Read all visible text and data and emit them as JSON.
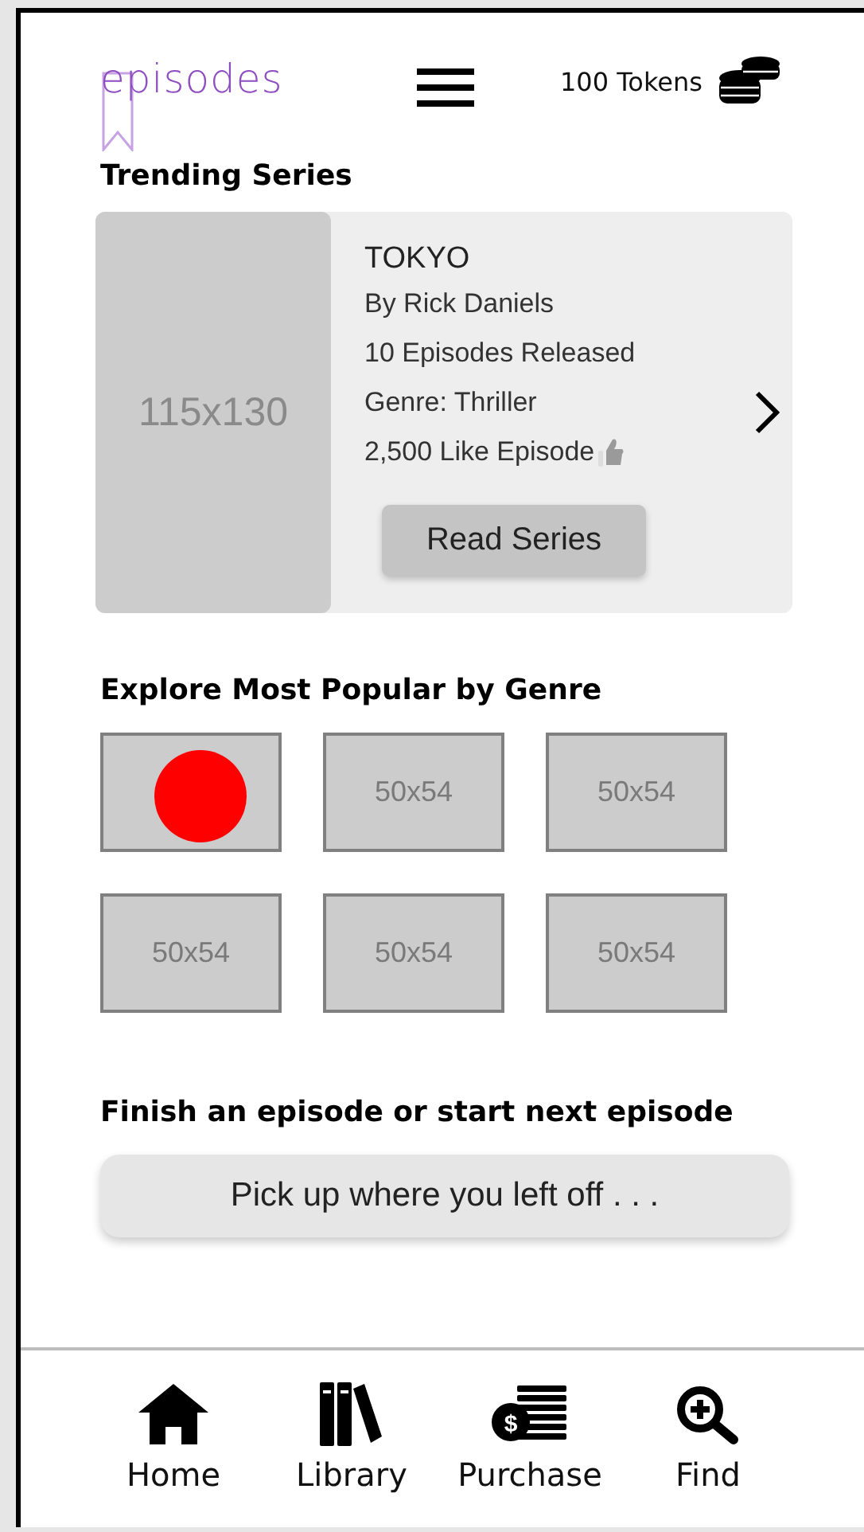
{
  "header": {
    "logo": "episodes",
    "tokens": "100 Tokens"
  },
  "trending": {
    "title": "Trending Series",
    "card": {
      "image_label": "115x130",
      "title": "TOKYO",
      "lines": [
        "By Rick Daniels",
        "10 Episodes Released",
        "Genre: Thriller",
        "2,500 Like Episode"
      ],
      "button": "Read Series"
    }
  },
  "genres": {
    "title": "Explore Most Popular by Genre",
    "tiles": [
      {
        "kind": "dot",
        "color": "#ff0000"
      },
      {
        "kind": "label",
        "label": "50x54"
      },
      {
        "kind": "label",
        "label": "50x54"
      },
      {
        "kind": "label",
        "label": "50x54"
      },
      {
        "kind": "label",
        "label": "50x54"
      },
      {
        "kind": "label",
        "label": "50x54"
      }
    ]
  },
  "continue": {
    "title": "Finish an episode or start next episode",
    "button": "Pick up where you left off . . ."
  },
  "nav": [
    {
      "kind": "home",
      "label": "Home"
    },
    {
      "kind": "library",
      "label": "Library"
    },
    {
      "kind": "purchase",
      "label": "Purchase",
      "icon_text": "$"
    },
    {
      "kind": "find",
      "label": "Find"
    }
  ]
}
